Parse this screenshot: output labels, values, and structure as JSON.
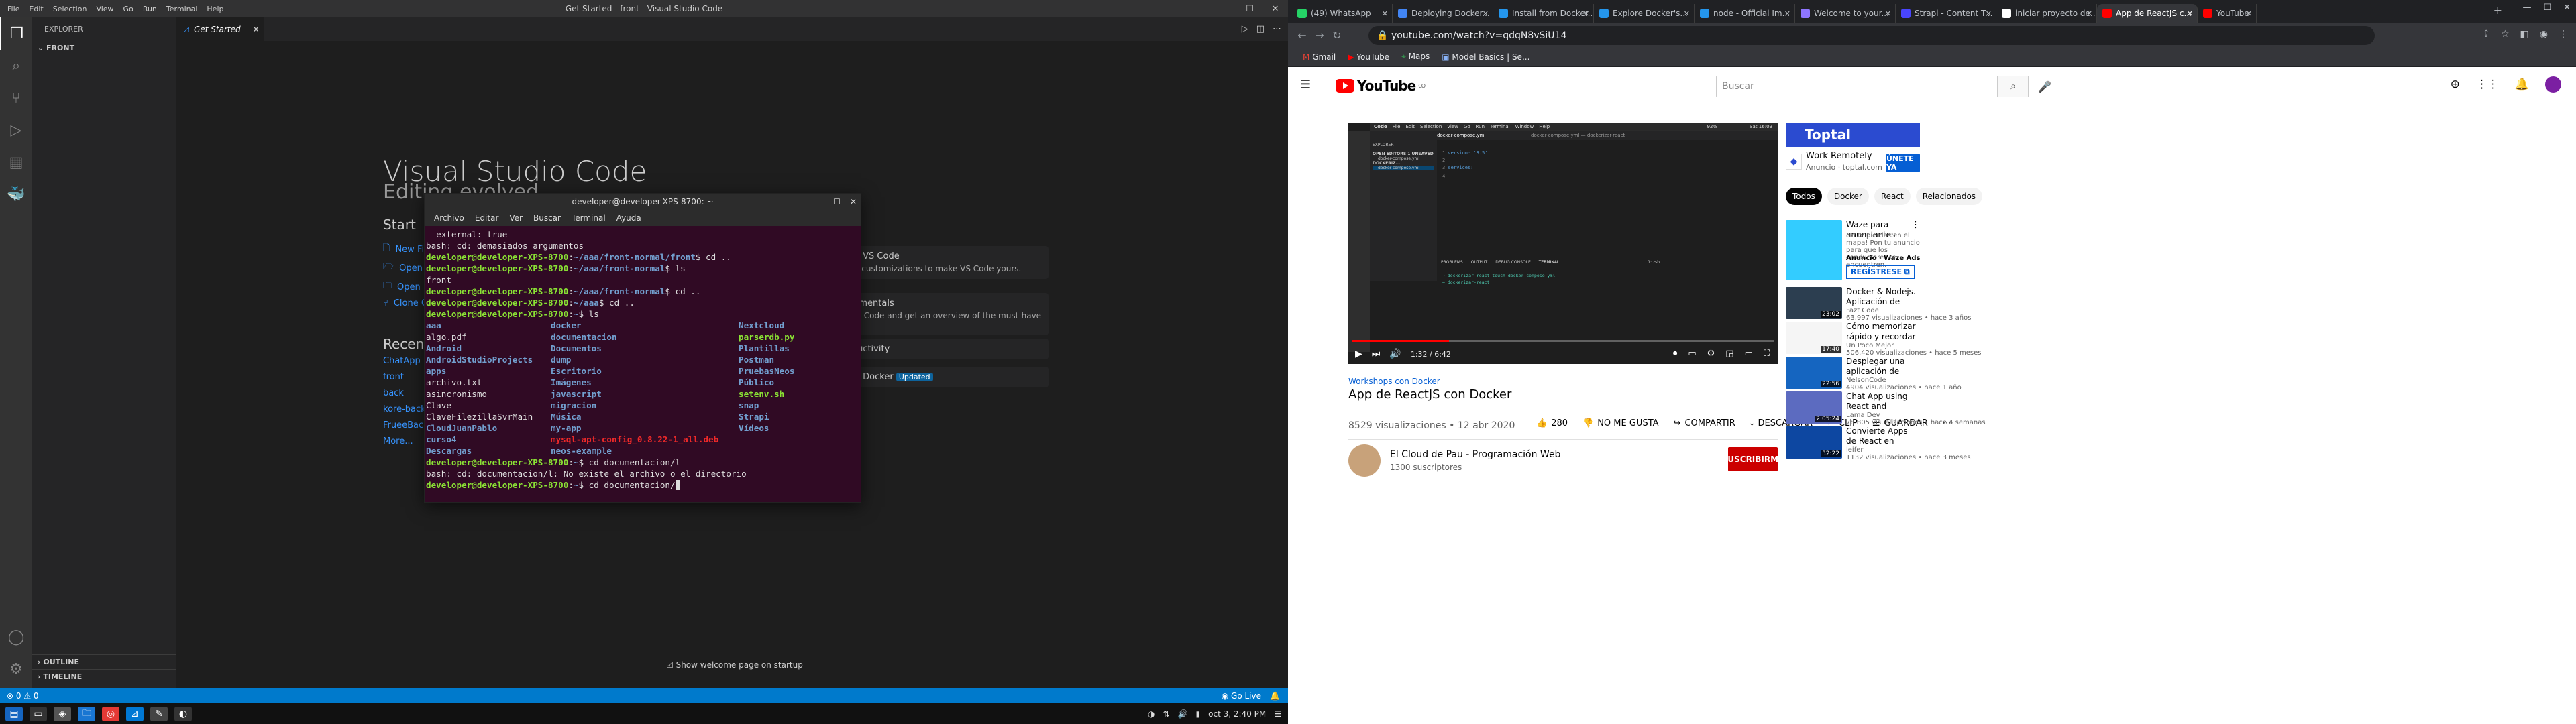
{
  "vscode": {
    "menu": [
      "File",
      "Edit",
      "Selection",
      "View",
      "Go",
      "Run",
      "Terminal",
      "Help"
    ],
    "title": "Get Started - front - Visual Studio Code",
    "explorer_label": "EXPLORER",
    "folder": "FRONT",
    "outline": "OUTLINE",
    "timeline": "TIMELINE",
    "tab": "Get Started",
    "welcome_title": "Visual Studio Code",
    "welcome_sub": "Editing evolved",
    "start_heading": "Start",
    "start_links": [
      "New File...",
      "Open File...",
      "Open Folder...",
      "Clone Git Repository..."
    ],
    "recent_heading": "Recent",
    "recent_items": [
      "ChatApp",
      "front",
      "back",
      "kore-back",
      "FrueeBack"
    ],
    "more": "More...",
    "walk_cards": [
      {
        "title": "Get Started with VS Code",
        "desc": "Discover the best customizations to make VS Code yours."
      },
      {
        "title": "Learn the Fundamentals",
        "desc": "Jump right into VS Code and get an overview of the must-have features."
      },
      {
        "title": "Boost your Productivity",
        "desc": ""
      },
      {
        "title": "Get Started with Docker",
        "desc": "",
        "badge": "Updated"
      }
    ],
    "show_welcome": "Show welcome page on startup",
    "status_left": [
      "⊗ 0 ⚠ 0"
    ],
    "status_right": "Go Live"
  },
  "terminal": {
    "title": "developer@developer-XPS-8700: ~",
    "menu": [
      "Archivo",
      "Editar",
      "Ver",
      "Buscar",
      "Terminal",
      "Ayuda"
    ],
    "lines": [
      "  external: true",
      "bash: cd: demasiados argumentos",
      "developer@developer-XPS-8700:~/aaa/front-normal/front$ cd ..",
      "developer@developer-XPS-8700:~/aaa/front-normal$ ls",
      "front",
      "developer@developer-XPS-8700:~/aaa/front-normal$ cd ..",
      "developer@developer-XPS-8700:~/aaa$ cd ..",
      "developer@developer-XPS-8700:~$ ls"
    ],
    "ls": [
      [
        "aaa",
        "docker",
        "Nextcloud"
      ],
      [
        "algo.pdf",
        "documentacion",
        "parserdb.py"
      ],
      [
        "Android",
        "Documentos",
        "Plantillas"
      ],
      [
        "AndroidStudioProjects",
        "dump",
        "Postman"
      ],
      [
        "apps",
        "Escritorio",
        "PruebasNeos"
      ],
      [
        "archivo.txt",
        "Imágenes",
        "Público"
      ],
      [
        "asincronismo",
        "javascript",
        "setenv.sh"
      ],
      [
        "Clave",
        "migracion",
        "snap"
      ],
      [
        "ClaveFilezillaSvrMain",
        "Música",
        "Strapi"
      ],
      [
        "CloudJuanPablo",
        "my-app",
        "Vídeos"
      ],
      [
        "curso4",
        "mysql-apt-config_0.8.22-1_all.deb",
        ""
      ],
      [
        "Descargas",
        "neos-example",
        ""
      ]
    ],
    "after": [
      "developer@developer-XPS-8700:~$ cd documentacion/l",
      "bash: cd: documentacion/l: No existe el archivo o el directorio",
      "developer@developer-XPS-8700:~$ cd documentacion/"
    ],
    "prompt_user": "developer@developer-XPS-8700",
    "external_prefix": "external: true",
    "external_suffix": "developer@developer-XPS-8700:~/aaa/front-normal/front$ cd ..cd .."
  },
  "taskbar": {
    "clock": "oct 3, 2:40 PM"
  },
  "chrome": {
    "tabs": [
      {
        "label": "(49) WhatsApp",
        "color": "#25d366"
      },
      {
        "label": "Deploying Docker...",
        "color": "#4285f4"
      },
      {
        "label": "Install from Docker...",
        "color": "#2496ed"
      },
      {
        "label": "Explore Docker's...",
        "color": "#2496ed"
      },
      {
        "label": "node - Official Im...",
        "color": "#2496ed"
      },
      {
        "label": "Welcome to your...",
        "color": "#8e75ff"
      },
      {
        "label": "Strapi - Content T...",
        "color": "#4945ff"
      },
      {
        "label": "iniciar proyecto de...",
        "color": "#fff"
      },
      {
        "label": "App de ReactJS c...",
        "color": "#ff0000"
      },
      {
        "label": "YouTube",
        "color": "#ff0000"
      }
    ],
    "url": "youtube.com/watch?v=qdqN8vSiU14",
    "bookmarks": [
      "Gmail",
      "YouTube",
      "Maps",
      "Model Basics | Se..."
    ]
  },
  "youtube": {
    "search_placeholder": "Buscar",
    "logo": "YouTube",
    "logo_country": "CO",
    "video": {
      "channel_tag": "Workshops con Docker",
      "title": "App de ReactJS con Docker",
      "views": "8529 visualizaciones • 12 abr 2020",
      "likes": "280",
      "dislike": "NO ME GUSTA",
      "share": "COMPARTIR",
      "download": "DESCARGAR",
      "clip": "CLIP",
      "save": "GUARDAR",
      "time": "1:32 / 6:42",
      "progress": 0.23
    },
    "vscode_in_video": {
      "app": "Code",
      "menu": [
        "File",
        "Edit",
        "Selection",
        "View",
        "Go",
        "Run",
        "Terminal",
        "Window",
        "Help"
      ],
      "clock": "Sat 16:09",
      "battery": "92%",
      "window_title": "docker-compose.yml — dockerizar-react",
      "tab": "docker-compose.yml",
      "explorer": "EXPLORER",
      "open_editors": "OPEN EDITORS  1 UNSAVED",
      "open_file": "docker-compose.yml",
      "folder": "DOCKERIZ...",
      "file": "docker-compose.yml",
      "code": [
        "version: '3.5'",
        "",
        "services:",
        ""
      ],
      "term_tabs": [
        "PROBLEMS",
        "OUTPUT",
        "DEBUG CONSOLE",
        "TERMINAL"
      ],
      "term_shell": "1: zsh",
      "term_lines": [
        "→ dockerizar-react touch docker-compose.yml",
        "→ dockerizar-react "
      ]
    },
    "channel": {
      "name": "El Cloud de Pau - Programación Web",
      "subs": "1300 suscriptores",
      "subscribe": "SUSCRIBIRME"
    },
    "ad": {
      "banner": "Toptal",
      "name": "Work Remotely",
      "meta": "Anuncio · toptal.com",
      "button": "ÚNETE YA"
    },
    "chips": [
      "Todos",
      "Docker",
      "React",
      "Relacionados"
    ],
    "waze": {
      "title": "Waze para anunciantes",
      "desc": "No te pierdas en el mapa! Pon tu anuncio para que los conductores te encuentren.",
      "meta": "Anuncio · Waze Ads",
      "button": "REGÍSTRESE"
    },
    "recs": [
      {
        "title": "Docker & Nodejs. Aplicación de Nodejs en Docker Container",
        "channel": "Fazt Code",
        "meta": "63.997 visualizaciones • hace 3 años",
        "dur": "23:02",
        "bg": "#2c3e50"
      },
      {
        "title": "Cómo memorizar rápido y recordar lo que aprendes -...",
        "channel": "Un Poco Mejor",
        "meta": "506.420 visualizaciones • hace 5 meses",
        "dur": "17:40",
        "bg": "#f5f5f5"
      },
      {
        "title": "Desplegar una aplicación de React y Express JS con Docke...",
        "channel": "NelsonCode",
        "meta": "4904 visualizaciones • hace 1 año",
        "dur": "22:56",
        "bg": "#1565c0"
      },
      {
        "title": "Chat App using React and Firebase | Realtime Private Ch...",
        "channel": "Lama Dev",
        "meta": "78.805 visualizaciones • hace 4 semanas",
        "dur": "2:05:24",
        "bg": "#5c6bc0"
      },
      {
        "title": "Convierte Apps de React en contenedores Docker",
        "channel": "leifer",
        "meta": "1132 visualizaciones • hace 3 meses",
        "dur": "32:22",
        "bg": "#0d47a1"
      }
    ]
  }
}
